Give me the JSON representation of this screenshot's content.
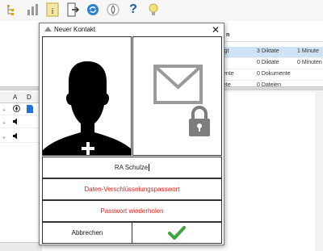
{
  "toolbar": {
    "icons": [
      "tree-view-icon",
      "bar-chart-icon",
      "info-icon",
      "export-icon",
      "sync-icon",
      "fire-icon",
      "help-icon",
      "bulb-icon"
    ],
    "help_glyph": "?"
  },
  "background": {
    "stats": [
      {
        "a": "igt",
        "b": "3 Diktate",
        "c": "1 Minute"
      },
      {
        "a": "",
        "b": "0 Diktate",
        "c": "0 Minuten"
      },
      {
        "a": "ente",
        "b": "0 Dokumente",
        "c": ""
      },
      {
        "a": "ete",
        "b": "0 Dateien",
        "c": ""
      }
    ],
    "header_fragment": "n",
    "grid_headers": [
      "A",
      "D"
    ]
  },
  "dialog": {
    "title": "Neuer Kontakt",
    "close_glyph": "✕",
    "name_value": "RA Schulze",
    "encryption_password_label": "Daten-Verschlüsselungspasswort",
    "repeat_password_label": "Passwort wiederholen",
    "cancel_label": "Abbrechen",
    "colors": {
      "accent_red": "#e0201a",
      "confirm_green": "#3aa53a",
      "silhouette": "#000000",
      "mail_grey": "#9a9a9a"
    }
  }
}
